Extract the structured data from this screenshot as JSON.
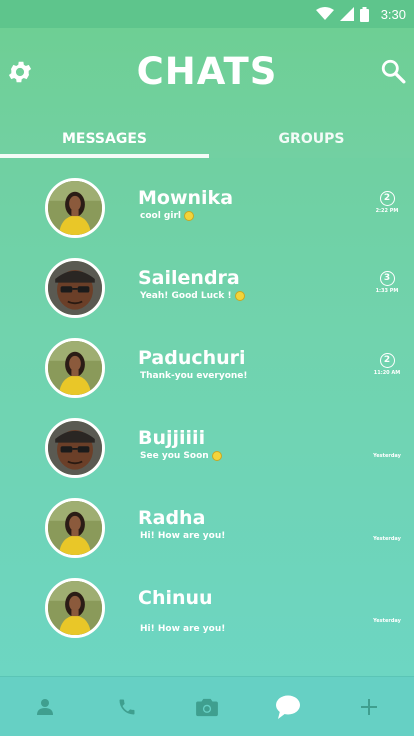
{
  "status_bar": {
    "time": "3:30",
    "icons": [
      "wifi-icon",
      "signal-icon",
      "battery-icon"
    ]
  },
  "app_bar": {
    "title": "CHATS",
    "left_icon": "gear-icon",
    "right_icon": "search-icon"
  },
  "tabs": [
    {
      "label": "MESSAGES",
      "selected": true
    },
    {
      "label": "GROUPS",
      "selected": false
    }
  ],
  "chats": [
    {
      "name": "Mownika",
      "message": "cool girl",
      "emoji": true,
      "unread": "2",
      "time": "2:22 PM",
      "avatar": "woman"
    },
    {
      "name": "Sailendra",
      "message": "Yeah! Good Luck !",
      "emoji": true,
      "unread": "3",
      "time": "1:33 PM",
      "avatar": "man"
    },
    {
      "name": "Paduchuri",
      "message": "Thank-you everyone!",
      "emoji": false,
      "unread": "2",
      "time": "11:20 AM",
      "avatar": "woman"
    },
    {
      "name": "Bujjiiii",
      "message": "See you Soon",
      "emoji": true,
      "unread": "",
      "time": "Yesterday",
      "avatar": "man"
    },
    {
      "name": "Radha",
      "message": "Hi! How are you!",
      "emoji": false,
      "unread": "",
      "time": "Yesterday",
      "avatar": "woman"
    },
    {
      "name": "Chinuu",
      "message": "Hi! How are you!",
      "emoji": false,
      "unread": "",
      "time": "Yesterday",
      "avatar": "woman"
    }
  ],
  "bottom_nav": [
    {
      "icon": "person-icon",
      "active": false
    },
    {
      "icon": "phone-icon",
      "active": false
    },
    {
      "icon": "camera-icon",
      "active": false
    },
    {
      "icon": "chat-bubble-icon",
      "active": true
    },
    {
      "icon": "plus-icon",
      "active": false
    }
  ],
  "colors": {
    "primary": "#6ecd97",
    "accent_bottom": "#66d0c4",
    "text": "#ffffff",
    "nav_inactive": "#3f9f8f"
  }
}
